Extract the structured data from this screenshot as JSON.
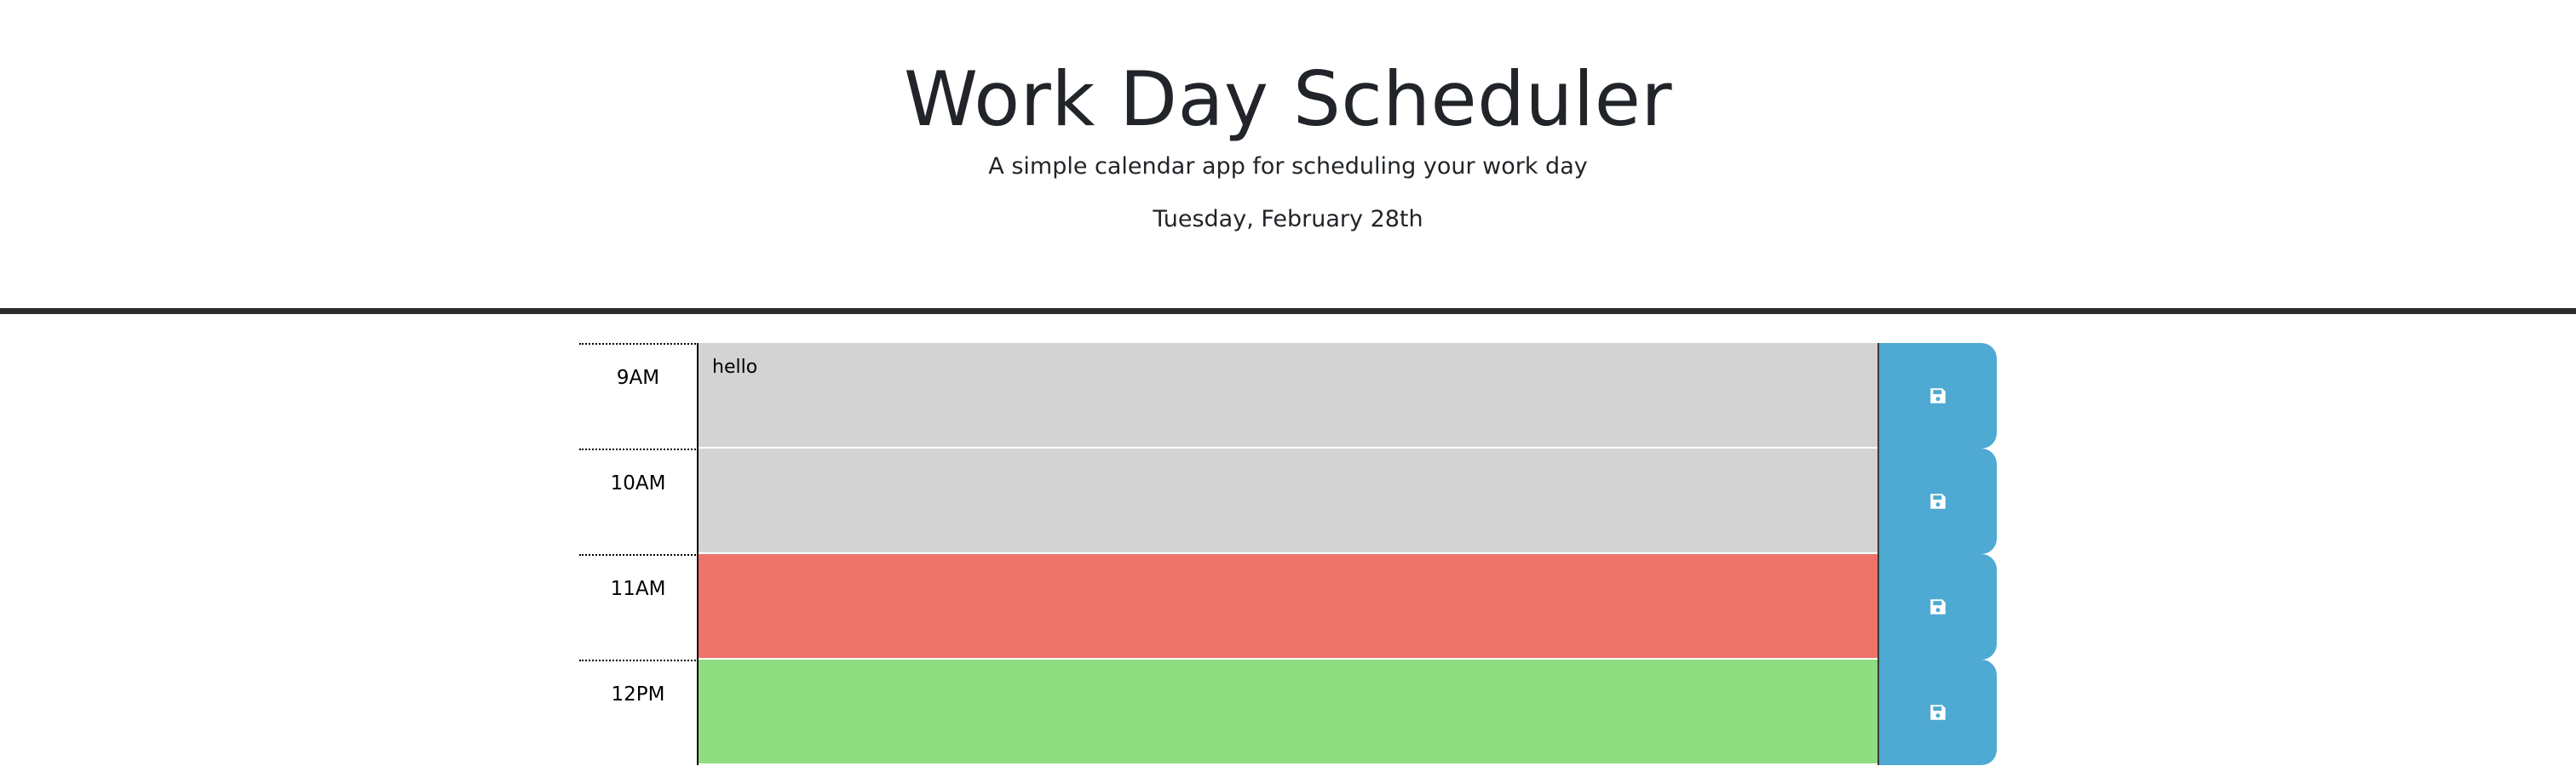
{
  "header": {
    "title": "Work Day Scheduler",
    "subtitle": "A simple calendar app for scheduling your work day",
    "current_day": "Tuesday, February 28th"
  },
  "colors": {
    "past": "#d3d3d3",
    "present": "#ee736a",
    "future": "#90dc80",
    "save_button": "#4eaad3"
  },
  "time_blocks": [
    {
      "hour": "9AM",
      "text": "hello",
      "state": "past",
      "save_icon": "floppy-disk-icon"
    },
    {
      "hour": "10AM",
      "text": "",
      "state": "past",
      "save_icon": "floppy-disk-icon"
    },
    {
      "hour": "11AM",
      "text": "",
      "state": "present",
      "save_icon": "floppy-disk-icon"
    },
    {
      "hour": "12PM",
      "text": "",
      "state": "future",
      "save_icon": "floppy-disk-icon"
    }
  ]
}
